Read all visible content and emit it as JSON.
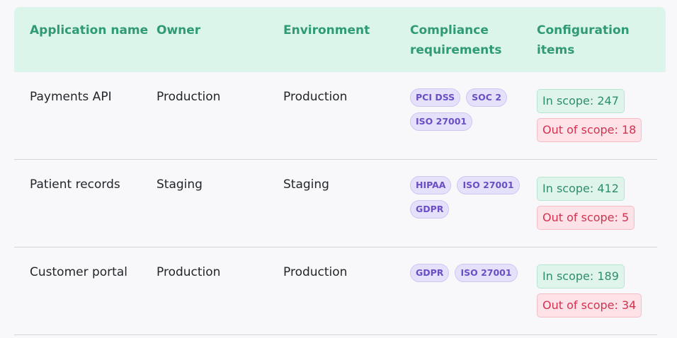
{
  "columns": [
    "Application name",
    "Owner",
    "Environment",
    "Compliance requirements",
    "Configuration items"
  ],
  "rows": [
    {
      "app": "Payments API",
      "owner": "Production",
      "environment": "Production",
      "compliance": [
        "PCI DSS",
        "SOC 2",
        "ISO 27001"
      ],
      "in_scope": "In scope: 247",
      "out_scope": "Out of scope: 18"
    },
    {
      "app": "Patient records",
      "owner": "Staging",
      "environment": "Staging",
      "compliance": [
        "HIPAA",
        "ISO 27001",
        "GDPR"
      ],
      "in_scope": "In scope: 412",
      "out_scope": "Out of scope: 5"
    },
    {
      "app": "Customer portal",
      "owner": "Production",
      "environment": "Production",
      "compliance": [
        "GDPR",
        "ISO 27001"
      ],
      "in_scope": "In scope: 189",
      "out_scope": "Out of scope: 34"
    }
  ],
  "colors": {
    "header_bg": "#dcf5eb",
    "header_text": "#2f9a73",
    "tag_text": "#6a4fc4",
    "in_scope": "#2e8e68",
    "out_scope": "#d2324f"
  }
}
